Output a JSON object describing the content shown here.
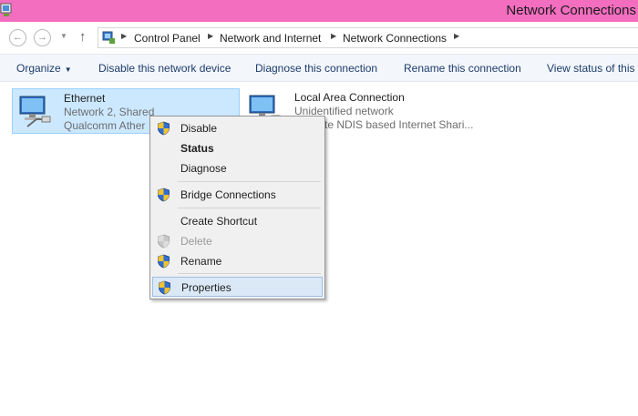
{
  "window": {
    "title": "Network Connections"
  },
  "address": {
    "crumbs": [
      "Control Panel",
      "Network and Internet",
      "Network Connections"
    ]
  },
  "toolbar": {
    "organize": "Organize",
    "disable_device": "Disable this network device",
    "diagnose": "Diagnose this connection",
    "rename": "Rename this connection",
    "view_status": "View status of this c"
  },
  "connections": [
    {
      "name": "Ethernet",
      "line1": "Network 2, Shared",
      "line2": "Qualcomm Ather",
      "selected": true
    },
    {
      "name": "Local Area Connection",
      "line1": "Unidentified network",
      "line2": "te NDIS based Internet Shari..."
    }
  ],
  "context_menu": {
    "items": [
      {
        "label": "Disable",
        "shield": true
      },
      {
        "label": "Status",
        "bold": true
      },
      {
        "label": "Diagnose"
      },
      {
        "label": "Bridge Connections",
        "shield": true
      },
      {
        "label": "Create Shortcut"
      },
      {
        "label": "Delete",
        "shield": true,
        "disabled": true
      },
      {
        "label": "Rename",
        "shield": true
      },
      {
        "label": "Properties",
        "shield": true,
        "highlighted": true
      }
    ]
  },
  "colors": {
    "titlebar": "#f46ec0",
    "toolbar_bg": "#f3f6fb",
    "selection": "#cce8ff",
    "menu_hover": "#dbe9f7"
  },
  "icons": {
    "title": "network-connections-icon",
    "address": "control-panel-icon",
    "connection": "network-adapter-icon",
    "uac": "uac-shield-icon"
  }
}
